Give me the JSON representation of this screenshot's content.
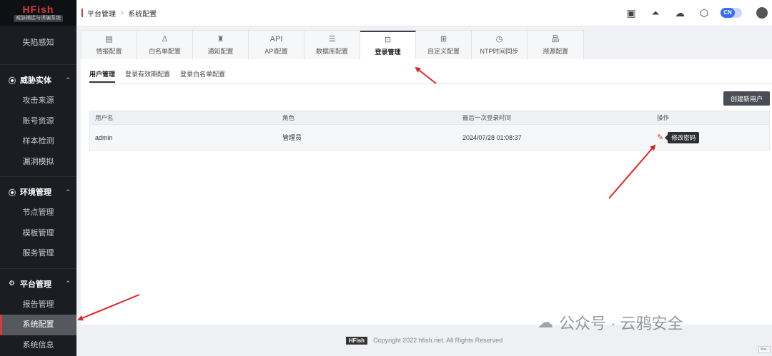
{
  "brand": {
    "title": "HFish",
    "subtitle": "威胁捕捉与诱骗系统"
  },
  "sidebar": {
    "top_item": "失陷感知",
    "groups": [
      {
        "title": "威胁实体",
        "icon": "target-icon",
        "items": [
          "攻击来源",
          "账号资源",
          "样本检测",
          "漏洞模拟"
        ]
      },
      {
        "title": "环境管理",
        "icon": "target-icon",
        "items": [
          "节点管理",
          "模板管理",
          "服务管理"
        ]
      },
      {
        "title": "平台管理",
        "icon": "gears-icon",
        "items": [
          "报告管理",
          "系统配置",
          "系统信息"
        ]
      }
    ]
  },
  "header": {
    "breadcrumb": [
      "平台管理",
      "系统配置"
    ],
    "icons": [
      "book-icon",
      "rocket-icon",
      "wechat-icon",
      "hexagon-icon"
    ],
    "lang_toggle": "CN"
  },
  "tabs": [
    {
      "icon": "doc-icon",
      "label": "情报配置"
    },
    {
      "icon": "user-outline-icon",
      "label": "白名单配置"
    },
    {
      "icon": "bell-icon",
      "label": "通知配置"
    },
    {
      "icon": "api-icon",
      "icon_text": "API",
      "label": "API配置"
    },
    {
      "icon": "database-icon",
      "label": "数据库配置"
    },
    {
      "icon": "login-icon",
      "label": "登录管理"
    },
    {
      "icon": "grid-icon",
      "label": "自定义配置"
    },
    {
      "icon": "clock-icon",
      "label": "NTP时间同步"
    },
    {
      "icon": "sitemap-icon",
      "label": "溯源配置"
    }
  ],
  "active_tab": "登录管理",
  "subtabs": [
    "用户管理",
    "登录有效期配置",
    "登录白名单配置"
  ],
  "create_button": "创建新用户",
  "table": {
    "headers": [
      "用户名",
      "角色",
      "最后一次登录时间",
      "操作"
    ],
    "rows": [
      {
        "username": "admin",
        "role": "管理员",
        "last_login": "2024/07/28 01:08:37",
        "action_tooltip": "修改密码"
      }
    ]
  },
  "footer": {
    "badge": "HFish",
    "copyright": "Copyright 2022 hfish.net. All Rights Reserved"
  },
  "watermark": "公众号 · 云鸦安全",
  "corner_tag": "WeLi"
}
